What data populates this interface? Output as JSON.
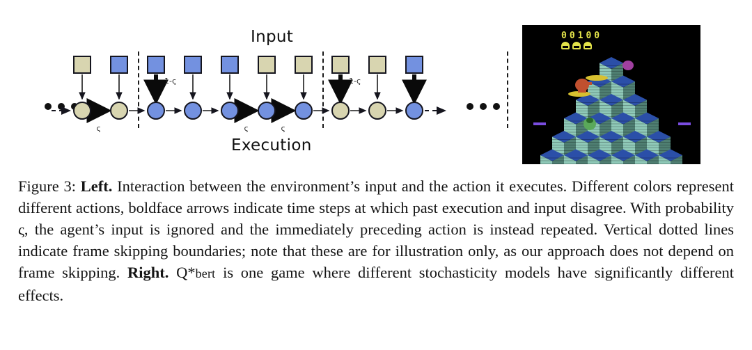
{
  "figure": {
    "left_panel": {
      "top_label": "Input",
      "bottom_label": "Execution",
      "ellipsis_glyph": "•",
      "prob_stay": "ς",
      "prob_switch": "1-ς",
      "colors": {
        "tan": "#d8d5b0",
        "blue": "#7391e0",
        "outline": "#15151e"
      },
      "timesteps": [
        {
          "index": 1,
          "input_color": "tan",
          "exec_color": "tan",
          "bold_input_arrow": false,
          "bold_exec_arrow": true,
          "below_label": "ς",
          "side_label": ""
        },
        {
          "index": 2,
          "input_color": "blue",
          "exec_color": "tan",
          "bold_input_arrow": false,
          "bold_exec_arrow": false,
          "below_label": "",
          "side_label": ""
        },
        {
          "index": 3,
          "input_color": "blue",
          "exec_color": "blue",
          "bold_input_arrow": true,
          "bold_exec_arrow": false,
          "below_label": "",
          "side_label": "1-ς"
        },
        {
          "index": 4,
          "input_color": "blue",
          "exec_color": "blue",
          "bold_input_arrow": false,
          "bold_exec_arrow": false,
          "below_label": "",
          "side_label": ""
        },
        {
          "index": 5,
          "input_color": "blue",
          "exec_color": "blue",
          "bold_input_arrow": false,
          "bold_exec_arrow": true,
          "below_label": "ς",
          "side_label": ""
        },
        {
          "index": 6,
          "input_color": "tan",
          "exec_color": "blue",
          "bold_input_arrow": false,
          "bold_exec_arrow": true,
          "below_label": "ς",
          "side_label": ""
        },
        {
          "index": 7,
          "input_color": "tan",
          "exec_color": "blue",
          "bold_input_arrow": false,
          "bold_exec_arrow": false,
          "below_label": "",
          "side_label": ""
        },
        {
          "index": 8,
          "input_color": "tan",
          "exec_color": "tan",
          "bold_input_arrow": true,
          "bold_exec_arrow": false,
          "below_label": "",
          "side_label": "1-ς"
        },
        {
          "index": 9,
          "input_color": "tan",
          "exec_color": "tan",
          "bold_input_arrow": false,
          "bold_exec_arrow": false,
          "below_label": "",
          "side_label": ""
        },
        {
          "index": 10,
          "input_color": "blue",
          "exec_color": "blue",
          "bold_input_arrow": true,
          "bold_exec_arrow": false,
          "below_label": "",
          "side_label": ""
        }
      ],
      "frame_skip_boundaries": [
        3,
        8,
        13
      ]
    },
    "right_panel": {
      "game_name": "Q*bert",
      "score": "00100",
      "lives": 3,
      "palette": {
        "background": "#000000",
        "cube_top": "#2b4fa8",
        "cube_left": "#8fc9b8",
        "cube_right": "#4f7f72",
        "score_yellow": "#e2e24a",
        "player_orange": "#c0502f",
        "enemy_green": "#5aa85a",
        "ball_purple": "#a040a0",
        "disc_yellow": "#d8c030"
      }
    }
  },
  "caption": {
    "figure_number": "Figure 3:",
    "bold_left": "Left.",
    "text_1": " Interaction between the environment’s input and the action it executes. Different colors represent different actions, boldface arrows indicate time steps at which past execution and input disagree. With probability ς, the agent’s input is ignored and the immediately preceding action is instead repeated. Vertical dotted lines indicate frame skipping boundaries; note that these are for illustration only, as our approach does not depend on frame skipping. ",
    "bold_right": "Right.",
    "text_2_pre": " Q*",
    "text_2_smallcaps": "bert",
    "text_2_post": " is one game where different stochasticity models have significantly different effects."
  }
}
